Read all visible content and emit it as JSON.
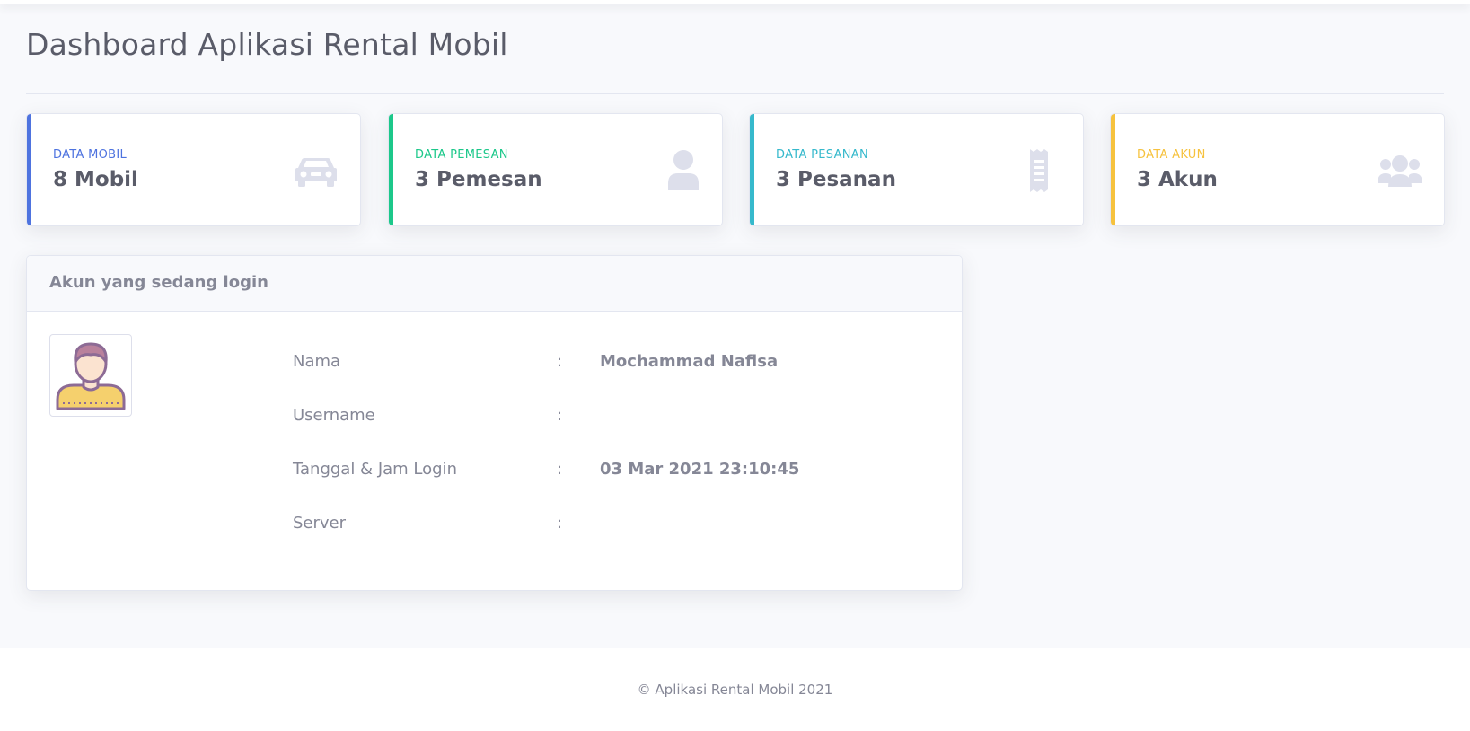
{
  "page": {
    "title": "Dashboard Aplikasi Rental Mobil"
  },
  "cards": [
    {
      "label": "DATA MOBIL",
      "value": "8 Mobil",
      "color": "#4e73df",
      "icon": "car-icon"
    },
    {
      "label": "DATA PEMESAN",
      "value": "3 Pemesan",
      "color": "#1cc88a",
      "icon": "user-icon"
    },
    {
      "label": "DATA PESANAN",
      "value": "3 Pesanan",
      "color": "#36b9cc",
      "icon": "receipt-icon"
    },
    {
      "label": "DATA AKUN",
      "value": "3 Akun",
      "color": "#f6c23e",
      "icon": "users-icon"
    }
  ],
  "login_panel": {
    "title": "Akun yang sedang login",
    "avatar_icon": "user-avatar-icon",
    "rows": [
      {
        "label": "Nama",
        "colon": ":",
        "value": "Mochammad Nafisa"
      },
      {
        "label": "Username",
        "colon": ":",
        "value": ""
      },
      {
        "label": "Tanggal & Jam Login",
        "colon": ":",
        "value": "03 Mar 2021 23:10:45"
      },
      {
        "label": "Server",
        "colon": ":",
        "value": ""
      }
    ]
  },
  "footer": {
    "text": "© Aplikasi Rental Mobil 2021"
  },
  "colors": {
    "background": "#f8f9fc",
    "text_dark": "#5a5c69",
    "text_muted": "#858796",
    "icon_muted": "#dddfeb"
  }
}
